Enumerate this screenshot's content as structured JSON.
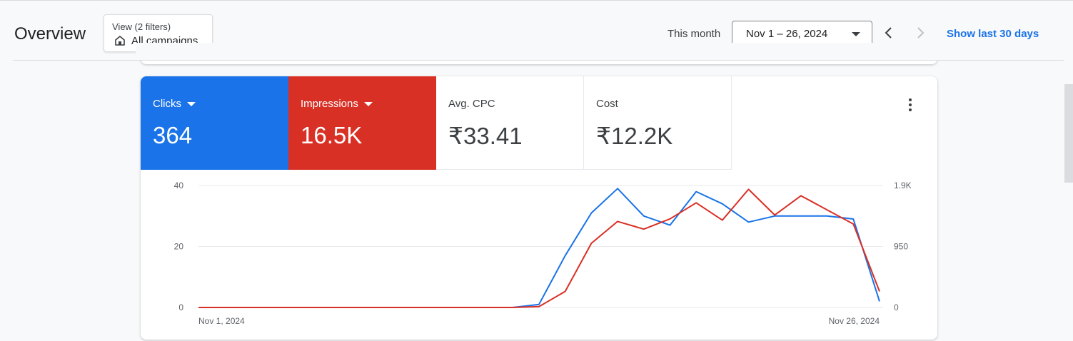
{
  "header": {
    "title": "Overview",
    "view_filter": {
      "label": "View (2 filters)",
      "value": "All campaigns",
      "icon": "home-icon"
    },
    "period_label": "This month",
    "date_range": "Nov 1 – 26, 2024",
    "show_last_link": "Show last 30 days"
  },
  "scorecards": [
    {
      "label": "Clicks",
      "value": "364",
      "color": "#1a73e8"
    },
    {
      "label": "Impressions",
      "value": "16.5K",
      "color": "#d93025"
    },
    {
      "label": "Avg. CPC",
      "value": "₹33.41"
    },
    {
      "label": "Cost",
      "value": "₹12.2K"
    }
  ],
  "chart_data": {
    "type": "line",
    "x": [
      "2024-11-01",
      "2024-11-02",
      "2024-11-03",
      "2024-11-04",
      "2024-11-05",
      "2024-11-06",
      "2024-11-07",
      "2024-11-08",
      "2024-11-09",
      "2024-11-10",
      "2024-11-11",
      "2024-11-12",
      "2024-11-13",
      "2024-11-14",
      "2024-11-15",
      "2024-11-16",
      "2024-11-17",
      "2024-11-18",
      "2024-11-19",
      "2024-11-20",
      "2024-11-21",
      "2024-11-22",
      "2024-11-23",
      "2024-11-24",
      "2024-11-25",
      "2024-11-26"
    ],
    "x_tick_labels": [
      "Nov 1, 2024",
      "Nov 26, 2024"
    ],
    "y_left_ticks": [
      "0",
      "20",
      "40"
    ],
    "y_right_ticks": [
      "0",
      "950",
      "1.9K"
    ],
    "ylim_left": [
      0,
      40
    ],
    "ylim_right": [
      0,
      1900
    ],
    "grid": true,
    "series": [
      {
        "name": "Clicks",
        "axis": "left",
        "color": "#1a73e8",
        "values": [
          0,
          0,
          0,
          0,
          0,
          0,
          0,
          0,
          0,
          0,
          0,
          0,
          0,
          1,
          17,
          31,
          39,
          30,
          27,
          38,
          34,
          28,
          30,
          30,
          30,
          29,
          2
        ]
      },
      {
        "name": "Impressions",
        "axis": "right",
        "color": "#d93025",
        "values": [
          0,
          0,
          0,
          0,
          0,
          0,
          0,
          0,
          0,
          0,
          0,
          0,
          0,
          13,
          250,
          1000,
          1340,
          1220,
          1380,
          1630,
          1360,
          1840,
          1440,
          1740,
          1520,
          1300,
          250
        ]
      }
    ]
  }
}
